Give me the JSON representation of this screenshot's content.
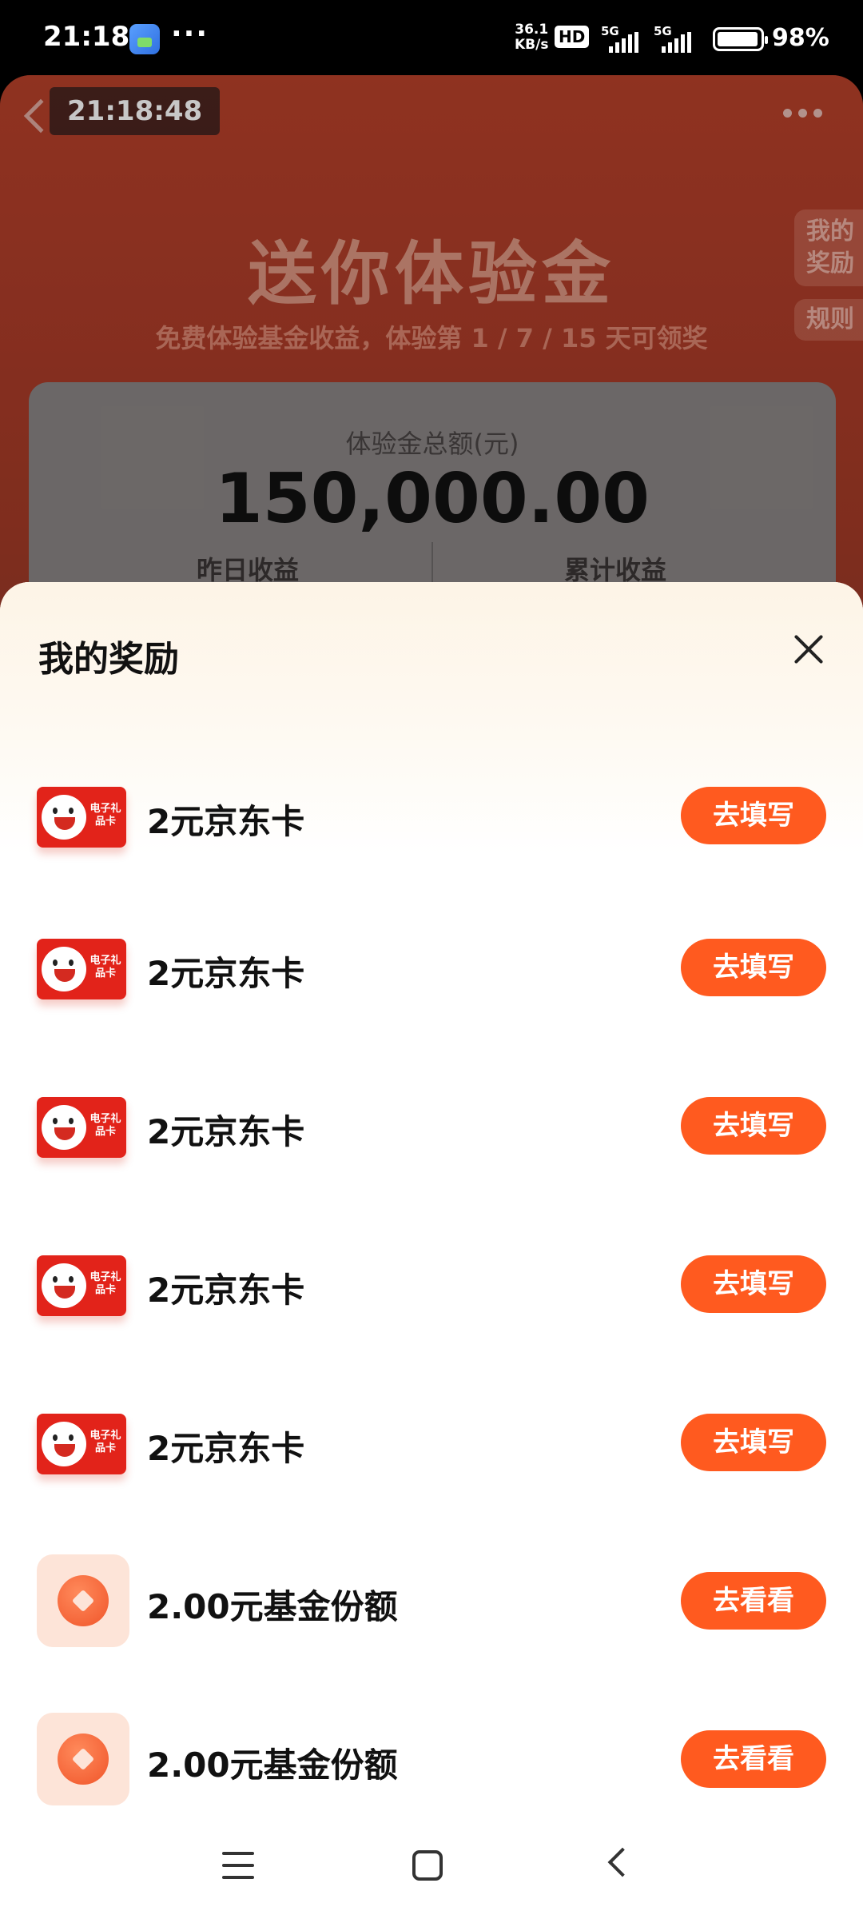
{
  "status_bar": {
    "time": "21:18",
    "dots": "···",
    "speed_value": "36.1",
    "speed_unit": "KB/s",
    "hd": "HD",
    "sim1": "5G",
    "sim2": "5G",
    "battery": "98%"
  },
  "background": {
    "clock": "21:18:48",
    "title": "送你体验金",
    "subtitle": "免费体验基金收益，体验第 1 / 7 / 15 天可领奖",
    "side_my_rewards": "我的奖励",
    "side_rules": "规则",
    "total_label": "体验金总额(元)",
    "total_amount": "150,000.00",
    "col_left": "昨日收益",
    "col_right": "累计收益"
  },
  "sheet": {
    "title": "我的奖励",
    "items": [
      {
        "name": "2元京东卡",
        "action": "去填写",
        "thumb": "jd-card",
        "card_text": "电子礼品卡"
      },
      {
        "name": "2元京东卡",
        "action": "去填写",
        "thumb": "jd-card",
        "card_text": "电子礼品卡"
      },
      {
        "name": "2元京东卡",
        "action": "去填写",
        "thumb": "jd-card",
        "card_text": "电子礼品卡"
      },
      {
        "name": "2元京东卡",
        "action": "去填写",
        "thumb": "jd-card",
        "card_text": "电子礼品卡"
      },
      {
        "name": "2元京东卡",
        "action": "去填写",
        "thumb": "jd-card",
        "card_text": "电子礼品卡"
      },
      {
        "name": "2.00元基金份额",
        "action": "去看看",
        "thumb": "fund-coin"
      },
      {
        "name": "2.00元基金份额",
        "action": "去看看",
        "thumb": "fund-coin"
      }
    ]
  },
  "colors": {
    "accent": "#ff5a1f",
    "jd_red": "#e2231a"
  }
}
